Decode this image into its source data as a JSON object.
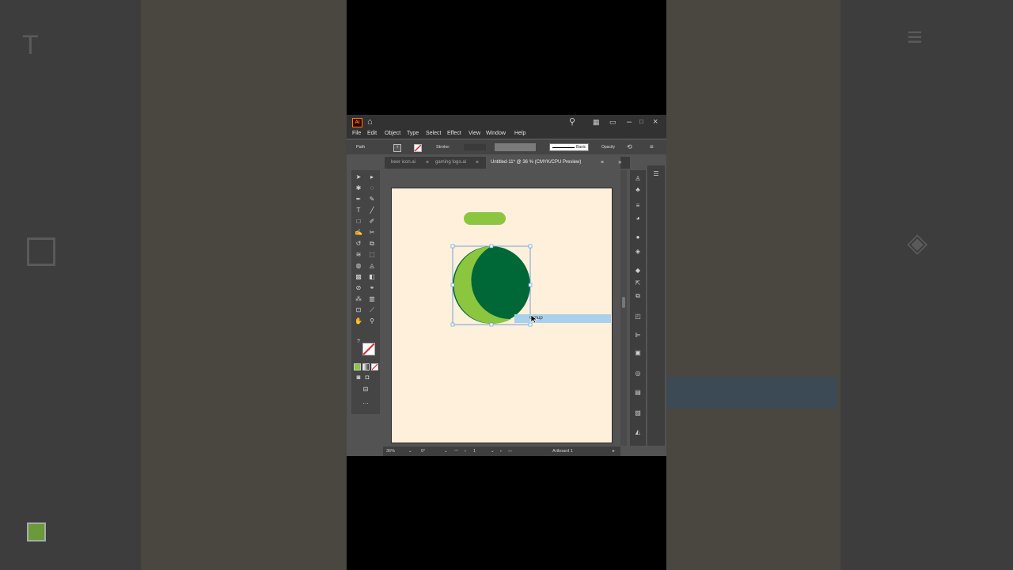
{
  "menu": [
    "File",
    "Edit",
    "Object",
    "Type",
    "Select",
    "Effect",
    "View",
    "Window",
    "Help"
  ],
  "control_bar": {
    "object_type": "Path",
    "stroke_label": "Stroke:",
    "brush_label": "Basic",
    "opacity_label": "Opacity"
  },
  "tabs": [
    {
      "label": "beer icon.ai",
      "active": false
    },
    {
      "label": "gaming logo.ai",
      "active": false
    },
    {
      "label": "Untitled-11* @ 36 % (CMYK/CPU Preview)",
      "active": true
    }
  ],
  "tooltip": "Group",
  "status": {
    "zoom": "36%",
    "rotation": "0°",
    "artboard_number": "1",
    "artboard_name": "Artboard 1"
  },
  "colors": {
    "artboard": "#fff0dc",
    "light_green": "#8cc63f",
    "dark_green": "#006837",
    "selection": "#4a90d9",
    "app_bg": "#535353"
  },
  "icons": {
    "ai_logo": "Ai",
    "home": "home-icon",
    "search": "search-icon",
    "more": "···"
  }
}
